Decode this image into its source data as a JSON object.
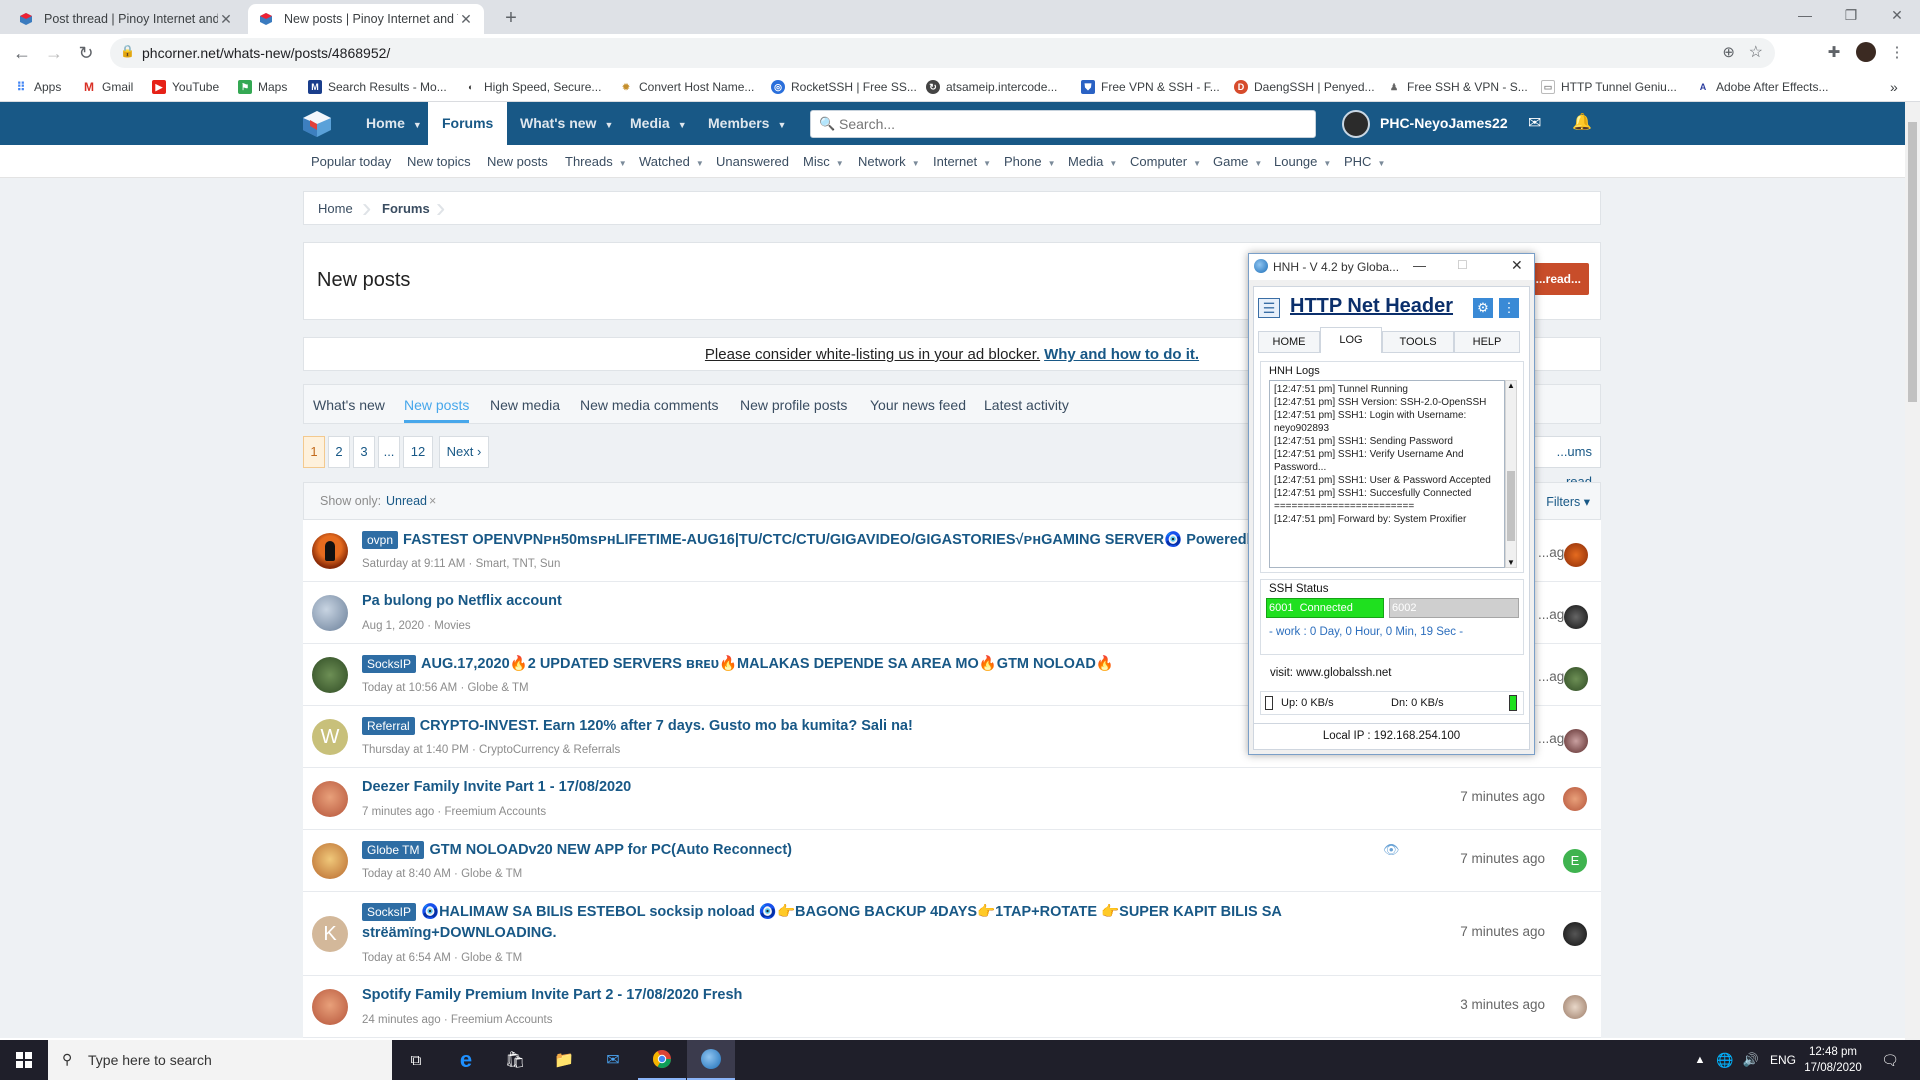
{
  "browser": {
    "tabs": [
      {
        "title": "Post thread | Pinoy Internet and T",
        "active": false
      },
      {
        "title": "New posts | Pinoy Internet and Te",
        "active": true
      }
    ],
    "url": "phcorner.net/whats-new/posts/4868952/",
    "bookmarks": [
      "Apps",
      "Gmail",
      "YouTube",
      "Maps",
      "Search Results - Mo...",
      "High Speed, Secure...",
      "Convert Host Name...",
      "RocketSSH | Free SS...",
      "atsameip.intercode...",
      "Free VPN & SSH - F...",
      "DaengSSH | Penyed...",
      "Free SSH & VPN - S...",
      "HTTP Tunnel Geniu...",
      "Adobe After Effects..."
    ],
    "more_bookmarks": "»"
  },
  "site": {
    "nav": [
      {
        "label": "Home",
        "caret": true,
        "selected": false
      },
      {
        "label": "Forums",
        "caret": false,
        "selected": true
      },
      {
        "label": "What's new",
        "caret": true,
        "selected": false
      },
      {
        "label": "Media",
        "caret": true,
        "selected": false
      },
      {
        "label": "Members",
        "caret": true,
        "selected": false
      }
    ],
    "search_placeholder": "Search...",
    "username": "PHC-NeyoJames22",
    "subnav": [
      {
        "label": "Popular today",
        "caret": false
      },
      {
        "label": "New topics",
        "caret": false
      },
      {
        "label": "New posts",
        "caret": false
      },
      {
        "label": "Threads",
        "caret": true
      },
      {
        "label": "Watched",
        "caret": true
      },
      {
        "label": "Unanswered",
        "caret": false
      },
      {
        "label": "Misc",
        "caret": true
      },
      {
        "label": "Network",
        "caret": true
      },
      {
        "label": "Internet",
        "caret": true
      },
      {
        "label": "Phone",
        "caret": true
      },
      {
        "label": "Media",
        "caret": true
      },
      {
        "label": "Computer",
        "caret": true
      },
      {
        "label": "Game",
        "caret": true
      },
      {
        "label": "Lounge",
        "caret": true
      },
      {
        "label": "PHC",
        "caret": true
      }
    ],
    "breadcrumb": [
      "Home",
      "Forums"
    ],
    "page_title": "New posts",
    "post_thread_btn": "...read...",
    "adblock_notice": "Please consider white-listing us in your ad blocker.",
    "adblock_link": "Why and how to do it.",
    "whatsnew_tabs": [
      "What's new",
      "New posts",
      "New media",
      "New media comments",
      "New profile posts",
      "Your news feed",
      "Latest activity"
    ],
    "pages": [
      "1",
      "2",
      "3",
      "...",
      "12",
      "Next ›"
    ],
    "mark_read_btn": "...ums read",
    "show_only_label": "Show only:",
    "show_only_value": "Unread",
    "filters_label": "Filters",
    "posts": [
      {
        "prefix": "ovpn",
        "title": "FASTEST OPENVPNᴘʜ50msᴘʜLIFETIME-AUG16|TU/CTC/CTU/GIGAVIDEO/GIGASTORIES√ᴘʜGAMING SERVER🧿 Poweredby: F",
        "meta": "Saturday at 9:11 AM · Smart, TNT, Sun",
        "ago": "...ago"
      },
      {
        "prefix": "",
        "title": "Pa bulong po Netflix account",
        "meta": "Aug 1, 2020 · Movies",
        "ago": "...ago"
      },
      {
        "prefix": "SocksIP",
        "title": "AUG.17,2020🔥2 UPDATED SERVERS ʙʀᴇᴜ🔥MALAKAS DEPENDE SA AREA MO🔥GTM NOLOAD🔥",
        "meta": "Today at 10:56 AM · Globe & TM",
        "ago": "...ago"
      },
      {
        "prefix": "Referral",
        "title": "CRYPTO-INVEST. Earn 120% after 7 days. Gusto mo ba kumita? Sali na!",
        "meta": "Thursday at 1:40 PM · CryptoCurrency & Referrals",
        "ago": "...ago",
        "avatar_letter": "W"
      },
      {
        "prefix": "",
        "title": "Deezer Family Invite Part 1 - 17/08/2020",
        "meta": "7 minutes ago · Freemium Accounts",
        "ago": "7 minutes ago"
      },
      {
        "prefix": "Globe TM",
        "title": "GTM NOLOADv20 NEW APP for PC(Auto Reconnect)",
        "meta": "Today at 8:40 AM · Globe & TM",
        "ago": "7 minutes ago",
        "small_avatar_letter": "E"
      },
      {
        "prefix": "SocksIP",
        "title": "🧿HALIMAW SA BILIS ESTEBOL socksip noload 🧿👉BAGONG BACKUP 4DAYS👉1TAP+ROTATE 👉SUPER KAPIT BILIS SA",
        "title2": "strëämïng+DOWNLOADING.",
        "meta": "Today at 6:54 AM · Globe & TM",
        "ago": "7 minutes ago",
        "avatar_letter": "K"
      },
      {
        "prefix": "",
        "title": "Spotify Family Premium Invite Part 2 - 17/08/2020 Fresh",
        "meta": "24 minutes ago · Freemium Accounts",
        "ago": "3 minutes ago"
      }
    ]
  },
  "hnh": {
    "window_title": "HNH - V 4.2 by Globa...",
    "app_title": "HTTP Net Header",
    "tabs": [
      "HOME",
      "LOG",
      "TOOLS",
      "HELP"
    ],
    "active_tab": "LOG",
    "logs_label": "HNH Logs",
    "logs": [
      "[12:47:51 pm] Tunnel Running",
      "[12:47:51 pm] SSH Version: SSH-2.0-OpenSSH",
      "[12:47:51 pm] SSH1: Login with Username: neyo902893",
      "[12:47:51 pm] SSH1: Sending Password",
      "[12:47:51 pm] SSH1: Verify Username And Password...",
      "[12:47:51 pm] SSH1: User & Password Accepted",
      "[12:47:51 pm] SSH1: Succesfully Connected",
      "========================",
      "[12:47:51 pm] Forward by: System Proxifier"
    ],
    "ssh_status_label": "SSH Status",
    "port1": "6001",
    "port1_status": "Connected",
    "port2": "6002",
    "work_time": "- work : 0 Day, 0 Hour, 0 Min, 19 Sec -",
    "visit": "visit: www.globalssh.net",
    "up": "Up: 0 KB/s",
    "down": "Dn: 0 KB/s",
    "local_ip": "Local IP : 192.168.254.100",
    "connected_color": "#1fe01f"
  },
  "taskbar": {
    "search_placeholder": "Type here to search",
    "lang": "ENG",
    "time": "12:48 pm",
    "date": "17/08/2020"
  }
}
